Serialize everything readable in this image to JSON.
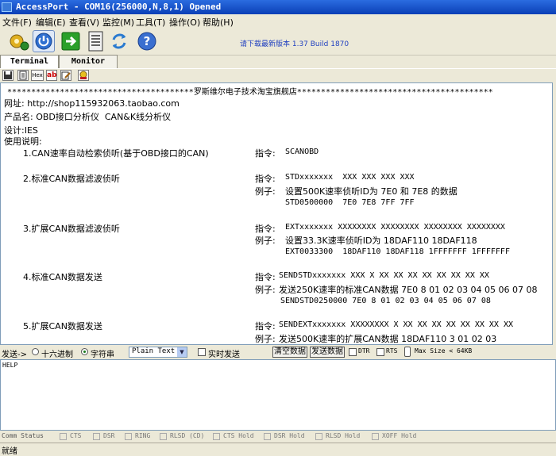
{
  "window": {
    "title": "AccessPort - COM16(256000,N,8,1) Opened"
  },
  "menu": [
    "文件(F)",
    "编辑(E)",
    "查看(V)",
    "监控(M)",
    "工具(T)",
    "操作(O)",
    "帮助(H)"
  ],
  "toolbar": {
    "notice": "请下载最新版本 1.37 Build 1870"
  },
  "tabs": {
    "terminal": "Terminal",
    "monitor": "Monitor"
  },
  "subtoolbar": {
    "hex": "Hex",
    "ab": "ab"
  },
  "terminal": {
    "banner": " ***************************************罗斯维尔电子技术淘宝旗舰店*****************************************",
    "website": "网址: http://shop115932063.taobao.com",
    "product": "产品名: OBD接口分析仪  CAN&K线分析仪",
    "design": "设计:IES",
    "usage": "使用说明:",
    "items": [
      {
        "title": "1.CAN速率自动检索侦听(基于OBD接口的CAN)",
        "lines": [
          {
            "label": "指令: ",
            "text": "SCANOBD"
          }
        ]
      },
      {
        "title": "2.标准CAN数据滤波侦听",
        "lines": [
          {
            "label": "指令: ",
            "text": "STDxxxxxxx  XXX XXX XXX XXX"
          },
          {
            "label": "例子: ",
            "text": "设置500K速率侦听ID为 7E0 和 7E8 的数据"
          },
          {
            "label": "",
            "text": "STD0500000  7E0 7E8 7FF 7FF"
          }
        ]
      },
      {
        "title": "3.扩展CAN数据滤波侦听",
        "lines": [
          {
            "label": "指令: ",
            "text": "EXTxxxxxxx XXXXXXXX XXXXXXXX XXXXXXXX XXXXXXXX"
          },
          {
            "label": "例子: ",
            "text": "设置33.3K速率侦听ID为 18DAF110 18DAF118"
          },
          {
            "label": "",
            "text": "EXT0033300  18DAF110 18DAF118 1FFFFFFF 1FFFFFFF"
          }
        ]
      },
      {
        "title": "4.标准CAN数据发送",
        "lines": [
          {
            "label": "指令:",
            "text": "SENDSTDxxxxxxx XXX X XX XX XX XX XX XX XX XX"
          },
          {
            "label": "例子:",
            "text": "发送250K速率的标准CAN数据 7E0 8 01 02 03 04 05 06 07 08"
          },
          {
            "label": "",
            "text": "SENDSTD0250000 7E0 8 01 02 03 04 05 06 07 08"
          }
        ]
      },
      {
        "title": "5.扩展CAN数据发送",
        "lines": [
          {
            "label": "指令:",
            "text": "SENDEXTxxxxxxx XXXXXXXX X XX XX XX XX XX XX XX XX"
          },
          {
            "label": "例子:",
            "text": "发送500K速率的扩展CAN数据 18DAF110 3 01 02 03"
          }
        ]
      }
    ]
  },
  "sendbar": {
    "send_label": "发送->",
    "hex_label": "十六进制",
    "string_label": "字符串",
    "mode_value": "Plain Text",
    "realtime_label": "实时发送",
    "clear_button": "清空数据",
    "send_button": "发送数据",
    "dtr_label": "DTR",
    "rts_label": "RTS",
    "maxsize_label": "Max Size < 64KB",
    "selected_format": "字符串"
  },
  "send_area": {
    "text": "HELP"
  },
  "comm_status": {
    "label": "Comm Status",
    "items": [
      "CTS",
      "DSR",
      "RING",
      "RLSD (CD)",
      "CTS Hold",
      "DSR Hold",
      "RLSD Hold",
      "XOFF Hold"
    ]
  },
  "statusbar": {
    "text": "就绪"
  }
}
